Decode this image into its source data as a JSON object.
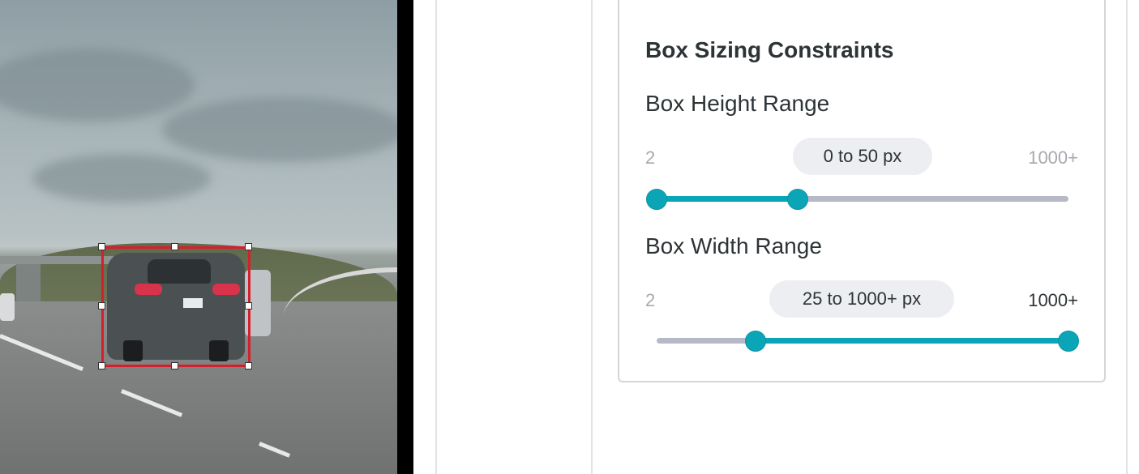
{
  "constraints": {
    "title": "Box Sizing Constraints",
    "height": {
      "label": "Box Height Range",
      "min_label": "2",
      "max_label": "1000+",
      "value_text": "0 to 50 px",
      "selected_low": 0,
      "selected_high": 50
    },
    "width": {
      "label": "Box Width Range",
      "min_label": "2",
      "max_label": "1000+",
      "value_text": "25 to 1000+ px",
      "selected_low": 25,
      "selected_high": 1000
    }
  },
  "colors": {
    "accent": "#0aa6b7",
    "track": "#b8b9c6",
    "bbox": "#d51f2d",
    "pill_bg": "#edeef1",
    "text": "#2d3436",
    "muted": "#a6a9ae"
  }
}
